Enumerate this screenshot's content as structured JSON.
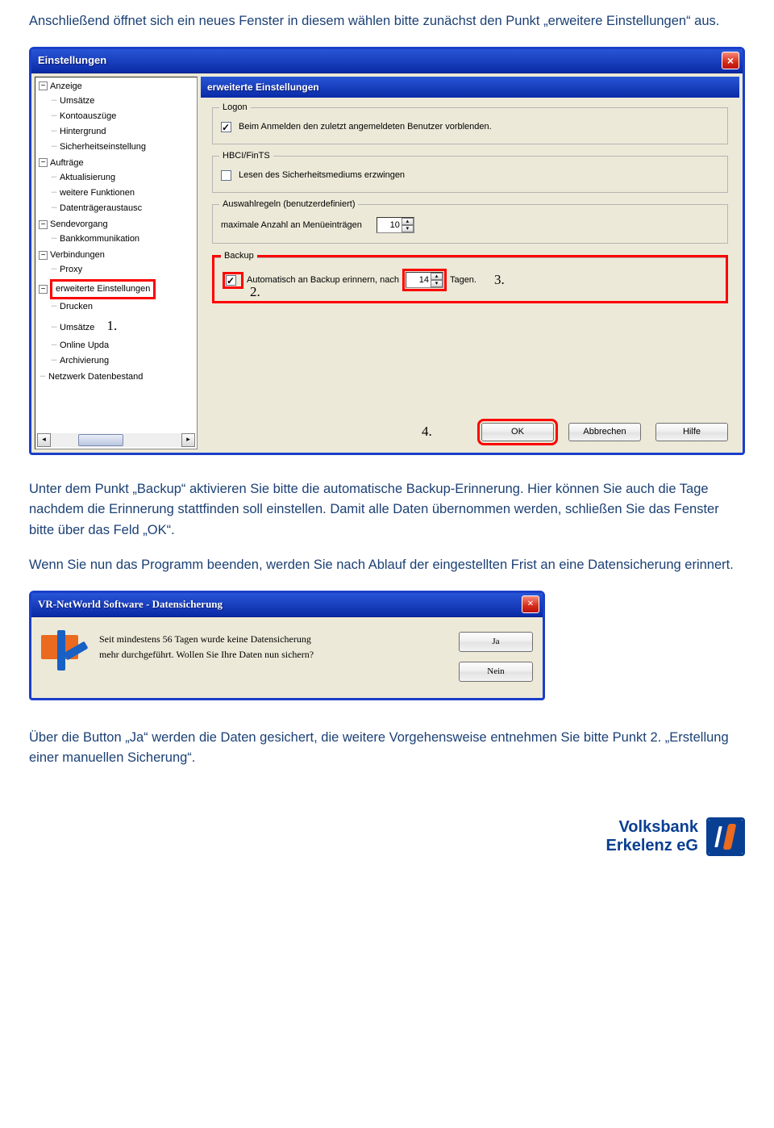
{
  "intro": "Anschließend öffnet sich ein neues Fenster in diesem wählen bitte zunächst den Punkt „erweitere Einstellungen“ aus.",
  "window1": {
    "title": "Einstellungen",
    "panel_header": "erweiterte Einstellungen",
    "tree": {
      "anzeige": "Anzeige",
      "umsaetze": "Umsätze",
      "kontoauszuege": "Kontoauszüge",
      "hintergrund": "Hintergrund",
      "sicherheit": "Sicherheitseinstellung",
      "auftraege": "Aufträge",
      "aktualisierung": "Aktualisierung",
      "weitere_funktionen": "weitere Funktionen",
      "datentraeger": "Datenträgeraustausc",
      "sendevorgang": "Sendevorgang",
      "bankkomm": "Bankkommunikation",
      "verbindungen": "Verbindungen",
      "proxy": "Proxy",
      "erweiterte": "erweiterte Einstellungen",
      "drucken": "Drucken",
      "umsaetze2": "Umsätze",
      "online_upda": "Online Upda",
      "archivierung": "Archivierung",
      "netzwerk": "Netzwerk Datenbestand"
    },
    "groups": {
      "logon": {
        "legend": "Logon",
        "label": "Beim Anmelden den zuletzt angemeldeten Benutzer vorblenden."
      },
      "hbci": {
        "legend": "HBCI/FinTS",
        "label": "Lesen des Sicherheitsmediums erzwingen"
      },
      "auswahl": {
        "legend": "Auswahlregeln (benutzerdefiniert)",
        "label": "maximale Anzahl an Menüeinträgen",
        "value": "10"
      },
      "backup": {
        "legend": "Backup",
        "label_a": "Automatisch an Backup erinnern, nach",
        "value": "14",
        "label_b": "Tagen."
      }
    },
    "callouts": {
      "c1": "1.",
      "c2": "2.",
      "c3": "3.",
      "c4": "4."
    },
    "buttons": {
      "ok": "OK",
      "cancel": "Abbrechen",
      "help": "Hilfe"
    }
  },
  "mid1": "Unter dem Punkt „Backup“ aktivieren Sie bitte die automatische Backup-Erinnerung. Hier können Sie auch die Tage nachdem die Erinnerung stattfinden soll einstellen. Damit alle Daten übernommen werden, schließen Sie das Fenster bitte über das Feld „OK“.",
  "mid2": "Wenn Sie nun das Programm beenden, werden Sie nach Ablauf der eingestellten Frist an eine Datensicherung erinnert.",
  "window2": {
    "title": "VR-NetWorld Software - Datensicherung",
    "line1a": "Seit mindestens   56   Tagen wurde keine Datensicherung",
    "line2": "mehr durchgeführt. Wollen Sie Ihre Daten nun sichern?",
    "yes": "Ja",
    "no": "Nein"
  },
  "outro": "Über die Button „Ja“ werden die Daten gesichert, die weitere Vorgehensweise entnehmen Sie bitte Punkt 2. „Erstellung einer manuellen Sicherung“.",
  "footer": {
    "l1": "Volksbank",
    "l2": "Erkelenz eG"
  }
}
